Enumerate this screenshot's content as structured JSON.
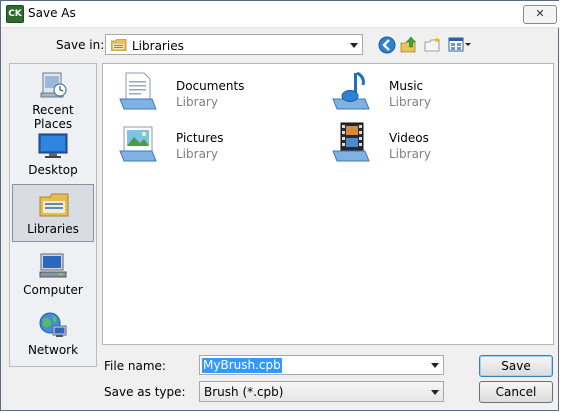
{
  "window": {
    "title": "Save As",
    "app_icon_text": "CK",
    "close_glyph": "✕"
  },
  "toolbar": {
    "save_in_label": "Save in:",
    "location": "Libraries",
    "icons": [
      "back-icon",
      "up-folder-icon",
      "new-folder-icon",
      "view-menu-icon"
    ]
  },
  "places": [
    {
      "label": "Recent Places",
      "icon": "recent-places-icon",
      "selected": false
    },
    {
      "label": "Desktop",
      "icon": "desktop-icon",
      "selected": false
    },
    {
      "label": "Libraries",
      "icon": "libraries-icon",
      "selected": true
    },
    {
      "label": "Computer",
      "icon": "computer-icon",
      "selected": false
    },
    {
      "label": "Network",
      "icon": "network-icon",
      "selected": false
    }
  ],
  "libraries": [
    {
      "name": "Documents",
      "type": "Library",
      "icon": "documents-library-icon"
    },
    {
      "name": "Music",
      "type": "Library",
      "icon": "music-library-icon"
    },
    {
      "name": "Pictures",
      "type": "Library",
      "icon": "pictures-library-icon"
    },
    {
      "name": "Videos",
      "type": "Library",
      "icon": "videos-library-icon"
    }
  ],
  "form": {
    "file_name_label": "File name:",
    "file_name_value": "MyBrush.cpb",
    "save_as_type_label": "Save as type:",
    "save_as_type_value": "Brush (*.cpb)",
    "save_button": "Save",
    "cancel_button": "Cancel"
  },
  "colors": {
    "selection": "#3399ff",
    "window_bg": "#f0f0f0"
  }
}
